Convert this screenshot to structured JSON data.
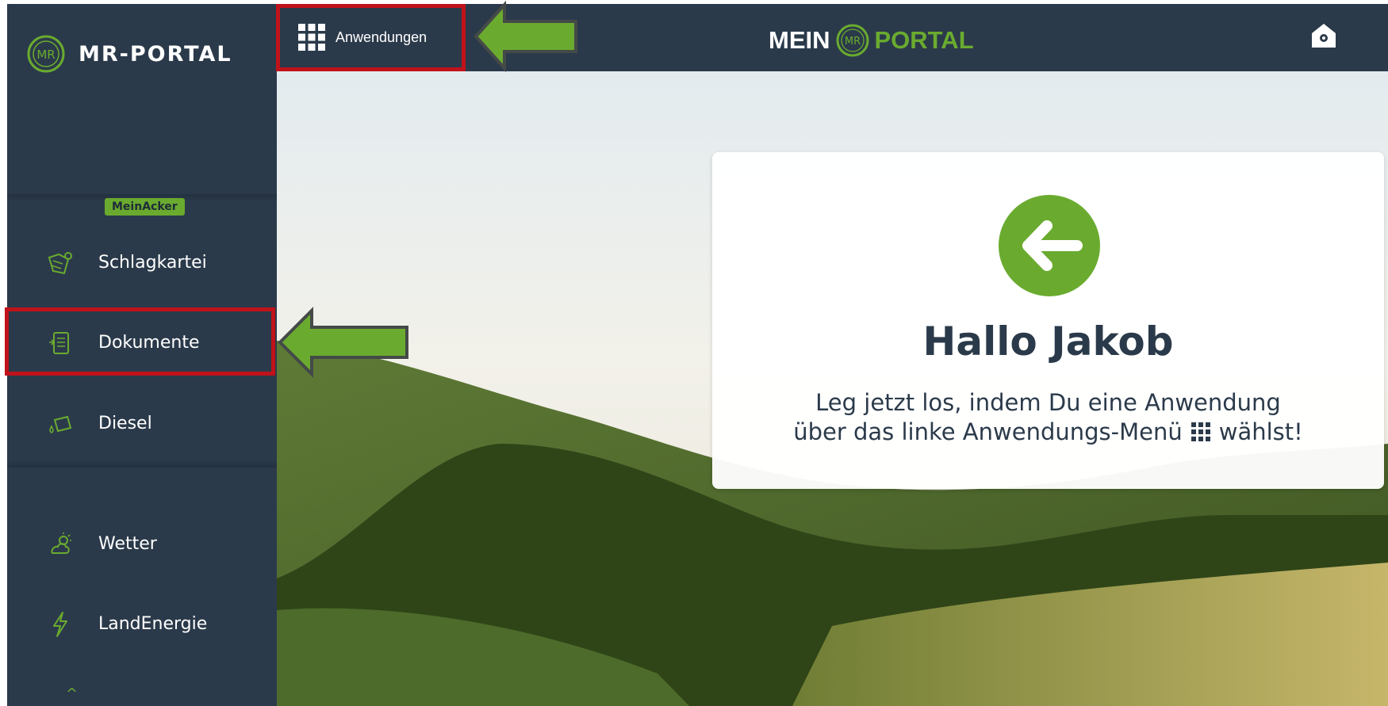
{
  "sidebar": {
    "logo_text": "MR-PORTAL",
    "logo_badge": "MR",
    "group_tag": "MeinAcker",
    "items": [
      {
        "label": "Schlagkartei",
        "icon": "field-map-icon"
      },
      {
        "label": "Dokumente",
        "icon": "documents-icon"
      },
      {
        "label": "Diesel",
        "icon": "fuel-drop-icon"
      },
      {
        "label": "Wetter",
        "icon": "weather-icon"
      },
      {
        "label": "LandEnergie",
        "icon": "lightning-icon"
      }
    ],
    "more_caret": "^"
  },
  "topbar": {
    "apps_label": "Anwendungen",
    "brand_left": "MEIN",
    "brand_badge": "MR",
    "brand_right": "PORTAL"
  },
  "card": {
    "title": "Hallo Jakob",
    "line1": "Leg jetzt los, indem Du eine Anwendung",
    "line2_pre": "über das linke Anwendungs-Menü",
    "line2_post": "wählst!"
  },
  "colors": {
    "sidebar_bg": "#2b3a4a",
    "accent_green": "#6aab2f",
    "highlight_red": "#c0121a",
    "arrow_green": "#6aab2f"
  }
}
